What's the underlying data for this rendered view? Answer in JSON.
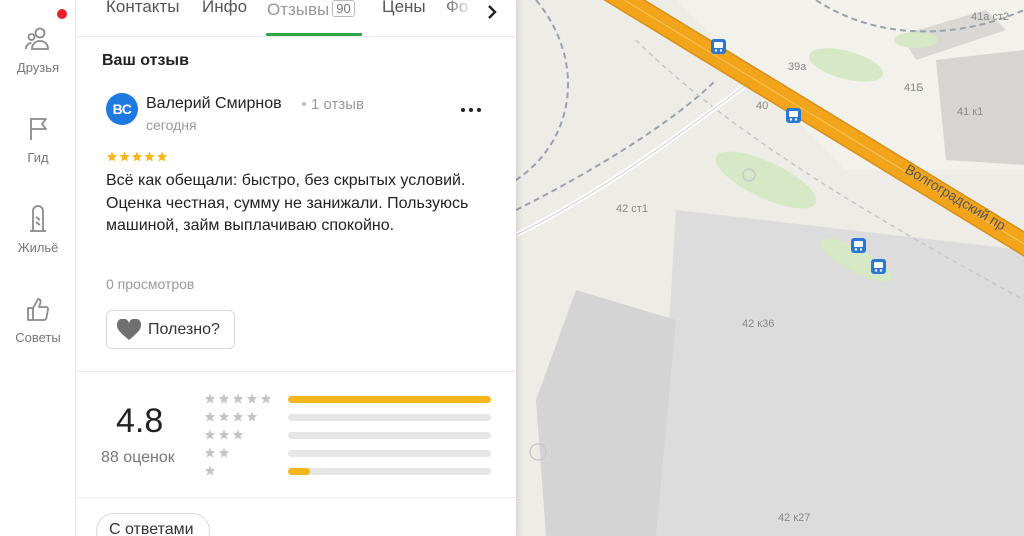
{
  "rail": {
    "items": [
      {
        "label": "Друзья",
        "icon": "friends-icon"
      },
      {
        "label": "Гид",
        "icon": "flag-icon"
      },
      {
        "label": "Жильё",
        "icon": "building-icon"
      },
      {
        "label": "Советы",
        "icon": "thumbs-up-icon"
      }
    ]
  },
  "tabs": {
    "items": [
      "Контакты",
      "Инфо",
      "Отзывы",
      "Цены",
      "Фо"
    ],
    "reviews_count": "90",
    "active": "Отзывы"
  },
  "review": {
    "section_title": "Ваш отзыв",
    "avatar_initials": "ВС",
    "author": "Валерий Смирнов",
    "author_reviews": "1 отзыв",
    "date": "сегодня",
    "stars": 5,
    "text": "Всё как обещали: быстро, без скрытых условий. Оценка честная, сумму не занижали. Пользуюсь машиной, займ выплачиваю спокойно.",
    "views": "0 просмотров",
    "useful_label": "Полезно?"
  },
  "rating": {
    "value": "4.8",
    "count_label": "88 оценок",
    "distribution": [
      {
        "stars": 5,
        "fraction": 1.0
      },
      {
        "stars": 4,
        "fraction": 0.0
      },
      {
        "stars": 3,
        "fraction": 0.0
      },
      {
        "stars": 2,
        "fraction": 0.0
      },
      {
        "stars": 1,
        "fraction": 0.11
      }
    ]
  },
  "filters": {
    "with_answers": "С ответами"
  },
  "map": {
    "labels": {
      "road": "Волгоградский пр",
      "b41a": "41а ст2",
      "b39a": "39а",
      "b41b": "41Б",
      "b41k1": "41 к1",
      "b40": "40",
      "b42st1": "42 ст1",
      "b42k36": "42 к36",
      "b42k27": "42 к27"
    }
  },
  "colors": {
    "accent_green": "#2ea44a",
    "avatar_blue": "#1e7ae0",
    "star_yellow": "#f5b61c",
    "notification_red": "#e8202a",
    "road_orange": "#f2a51a",
    "transit_blue": "#2a78d6"
  }
}
